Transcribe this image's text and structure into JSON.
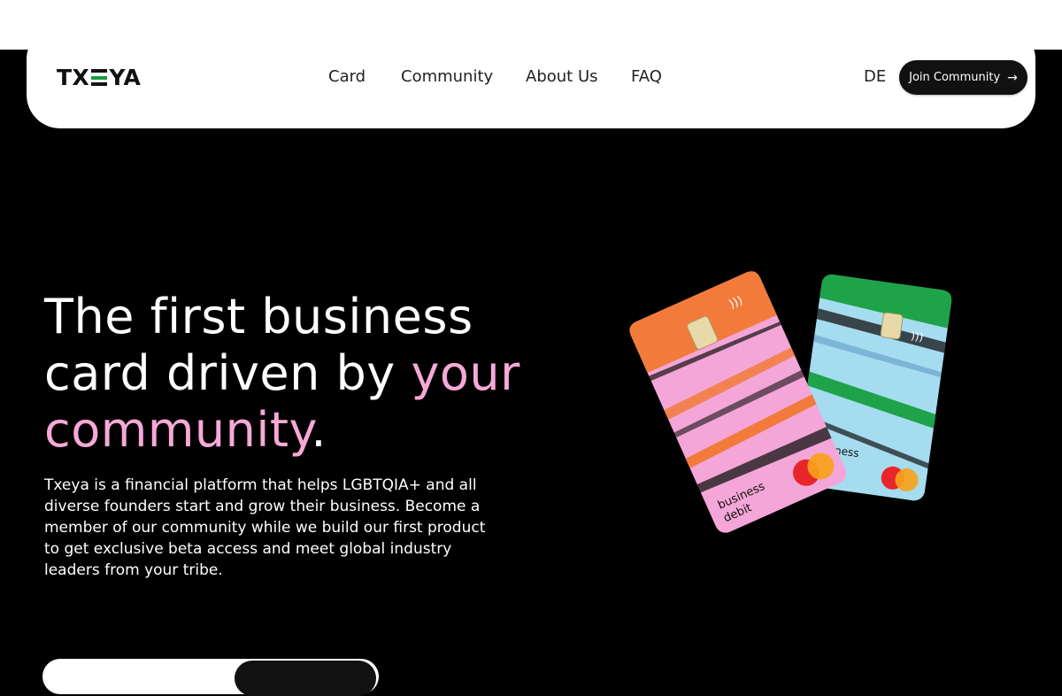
{
  "brand": {
    "logo_text_left": "TX",
    "logo_text_right": "YA",
    "logo_accent": "#1a9c3e"
  },
  "nav": {
    "items": [
      {
        "label": "Card"
      },
      {
        "label": "Community"
      },
      {
        "label": "About Us"
      },
      {
        "label": "FAQ"
      }
    ],
    "language": "DE",
    "cta_label": "Join Community",
    "cta_icon": "arrow-right-icon"
  },
  "hero": {
    "title_line1": "The first business",
    "title_line2_plain": "card driven by ",
    "title_line2_accent": "your",
    "title_line3_accent": "community",
    "title_line3_plain": ".",
    "accent_color": "#f6a9d6",
    "body": "Txeya is a financial platform that helps LGBTQIA+ and all diverse founders start and grow their business. Become a member of our community while we build our first product to get exclusive beta access and meet global industry leaders from your tribe."
  },
  "cards": {
    "front": {
      "line1": "business",
      "line2": "debit",
      "colors": [
        "#f27b3c",
        "#f5a6d8"
      ]
    },
    "back": {
      "line1": "business",
      "line2": "debit",
      "colors": [
        "#1fa34a",
        "#a6dcf0"
      ]
    }
  }
}
